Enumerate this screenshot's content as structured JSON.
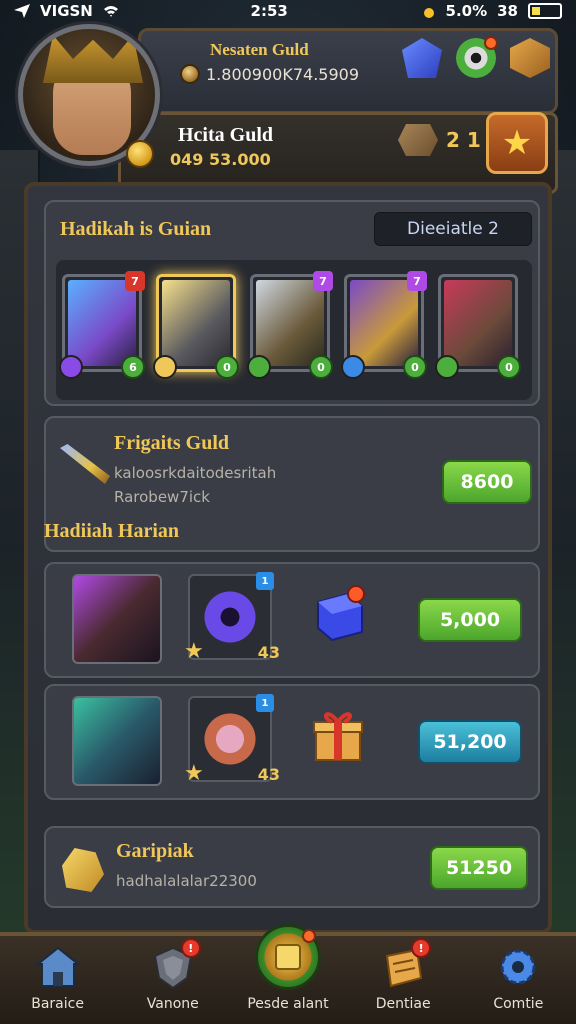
{
  "status_bar": {
    "carrier": "VIGSN",
    "time": "2:53",
    "battery_percent": "5.0%",
    "signal": "38"
  },
  "header": {
    "guild_name": "Nesaten Guld",
    "guild_coins": "1.800900K74.5909",
    "player_name": "Hcita Guld",
    "player_gold": "049 53.000",
    "rank_value": "2 1",
    "icons": [
      "gem-icon",
      "target-icon",
      "box-icon",
      "star-icon"
    ]
  },
  "heroes": {
    "title": "Hadikah is Guian",
    "tag": "Dieeiatle 2",
    "cards": [
      {
        "badge": "7",
        "badge_color": "#d8362a",
        "level": "6",
        "element_color": "#8a4ae6",
        "art": "linear-gradient(135deg,#5ab0ff 0%,#7a4ac8 60%,#2a2040 100%)",
        "gold": false
      },
      {
        "badge": "",
        "badge_color": "#f0c85a",
        "level": "0",
        "element_color": "#f0c85a",
        "art": "linear-gradient(135deg,#f6e08a 0%,#5a5a60 60%,#2a2a30 100%)",
        "gold": true
      },
      {
        "badge": "7",
        "badge_color": "#b04ae6",
        "level": "0",
        "element_color": "#4cae3c",
        "art": "linear-gradient(135deg,#cfd8e0 0%,#6a5a3a 60%,#2a2a20 100%)",
        "gold": false
      },
      {
        "badge": "7",
        "badge_color": "#b04ae6",
        "level": "0",
        "element_color": "#3a8ae6",
        "art": "linear-gradient(135deg,#7a4ac8 0%,#c89a3a 60%,#2a2040 100%)",
        "gold": false
      },
      {
        "badge": "",
        "badge_color": "#b04ae6",
        "level": "0",
        "element_color": "#4cae3c",
        "art": "linear-gradient(135deg,#c83a5a 0%,#6a4a3a 60%,#2a2030 100%)",
        "gold": false
      }
    ]
  },
  "guild_gift": {
    "title": "Frigaits Guld",
    "desc_line1": "kaloosrkdaitodesritah",
    "desc_line2": "Rarobew7ick",
    "button": "8600"
  },
  "daily": {
    "title": "Hadiiah Harian",
    "rows": [
      {
        "item_badge": "1",
        "item_count": "43",
        "button": "5,000",
        "button_style": "green",
        "hero_art": "linear-gradient(135deg,#b04ae6 0%,#4a2a30 50%,#1a1420 100%)",
        "item_art": "radial-gradient(circle,#1a1030 0 20%,#6a4ae6 21% 55%,#2a2d34 56%)",
        "chest": "blue-box"
      },
      {
        "item_badge": "1",
        "item_count": "43",
        "button": "51,200",
        "button_style": "blue",
        "hero_art": "linear-gradient(135deg,#3ac0a0 0%,#2a5a6a 50%,#1a2030 100%)",
        "item_art": "radial-gradient(circle,#e6a8c0 0 30%,#c86a4a 31% 55%,#2a2d34 56%)",
        "chest": "gift-box"
      }
    ]
  },
  "last_reward": {
    "title": "Garipiak",
    "desc": "hadhalalalar22300",
    "button": "51250"
  },
  "nav": [
    {
      "label": "Baraice",
      "icon": "house-icon",
      "badge": false
    },
    {
      "label": "Vanone",
      "icon": "shield-icon",
      "badge": true
    },
    {
      "label": "Pesde alant",
      "icon": "guild-icon",
      "badge": false,
      "center": true
    },
    {
      "label": "Dentiae",
      "icon": "scroll-icon",
      "badge": true
    },
    {
      "label": "Comtie",
      "icon": "gear-icon",
      "badge": false
    }
  ],
  "colors": {
    "accent_gold": "#f0c85a",
    "button_green": "#4ca62c",
    "button_blue": "#1e7ea0",
    "frame_brown": "#4a3a28"
  }
}
